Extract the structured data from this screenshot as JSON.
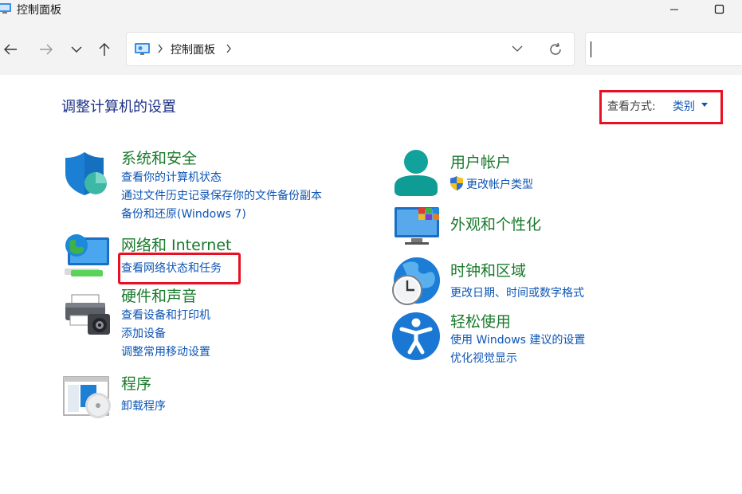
{
  "window": {
    "title": "控制面板"
  },
  "address_bar": {
    "breadcrumb": "控制面板"
  },
  "search": {
    "value": ""
  },
  "main": {
    "heading": "调整计算机的设置",
    "view_by": {
      "label": "查看方式:",
      "value": "类别"
    }
  },
  "categories": {
    "system_security": {
      "title": "系统和安全",
      "links": [
        "查看你的计算机状态",
        "通过文件历史记录保存你的文件备份副本",
        "备份和还原(Windows 7)"
      ]
    },
    "network": {
      "title": "网络和 Internet",
      "links": [
        "查看网络状态和任务"
      ]
    },
    "hardware": {
      "title": "硬件和声音",
      "links": [
        "查看设备和打印机",
        "添加设备",
        "调整常用移动设置"
      ]
    },
    "programs": {
      "title": "程序",
      "links": [
        "卸载程序"
      ]
    },
    "user_accounts": {
      "title": "用户帐户",
      "links": [
        "更改帐户类型"
      ]
    },
    "appearance": {
      "title": "外观和个性化"
    },
    "clock_region": {
      "title": "时钟和区域",
      "links": [
        "更改日期、时间或数字格式"
      ]
    },
    "ease_of_access": {
      "title": "轻松使用",
      "links": [
        "使用 Windows 建议的设置",
        "优化视觉显示"
      ]
    }
  },
  "colors": {
    "category_title": "#1a7a2c",
    "link": "#0d55b5",
    "heading": "#1e3287",
    "highlight": "#e81123"
  }
}
